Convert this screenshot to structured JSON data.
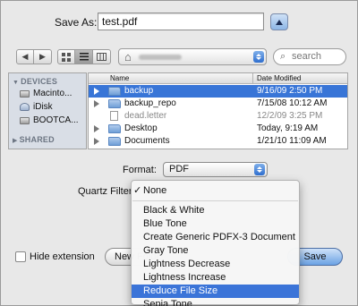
{
  "save_as": {
    "label": "Save As:",
    "filename": "test.pdf"
  },
  "toolbar": {
    "back": "◀",
    "forward": "▶",
    "search_placeholder": "search"
  },
  "sidebar": {
    "devices_heading": "DEVICES",
    "shared_heading": "SHARED",
    "devices": [
      {
        "label": "Macinto...",
        "icon": "hard-drive-icon"
      },
      {
        "label": "iDisk",
        "icon": "idisk-icon"
      },
      {
        "label": "BOOTCA...",
        "icon": "hard-drive-icon"
      }
    ]
  },
  "file_list": {
    "columns": {
      "name": "Name",
      "date": "Date Modified"
    },
    "rows": [
      {
        "name": "backup",
        "date": "9/16/09 2:50 PM",
        "kind": "folder",
        "selected": true
      },
      {
        "name": "backup_repo",
        "date": "7/15/08 10:12 AM",
        "kind": "folder",
        "selected": false
      },
      {
        "name": "dead.letter",
        "date": "12/2/09 3:25 PM",
        "kind": "file",
        "selected": false
      },
      {
        "name": "Desktop",
        "date": "Today, 9:19 AM",
        "kind": "folder",
        "selected": false
      },
      {
        "name": "Documents",
        "date": "1/21/10 11:09 AM",
        "kind": "folder",
        "selected": false
      }
    ]
  },
  "format": {
    "label": "Format:",
    "value": "PDF"
  },
  "quartz_filter": {
    "label": "Quartz Filter",
    "selected_check": "✓",
    "menu": {
      "none": "None",
      "items": [
        "Black & White",
        "Blue Tone",
        "Create Generic PDFX-3 Document",
        "Gray Tone",
        "Lightness Decrease",
        "Lightness Increase",
        "Reduce File Size",
        "Sepia Tone"
      ],
      "highlighted": "Reduce File Size"
    }
  },
  "bottom": {
    "hide_extension": "Hide extension",
    "new_folder": "New Folder",
    "save": "Save"
  },
  "colors": {
    "selection": "#3875d7",
    "menu_highlight": "#3b74d8",
    "sidebar_bg": "#d9dee6"
  }
}
